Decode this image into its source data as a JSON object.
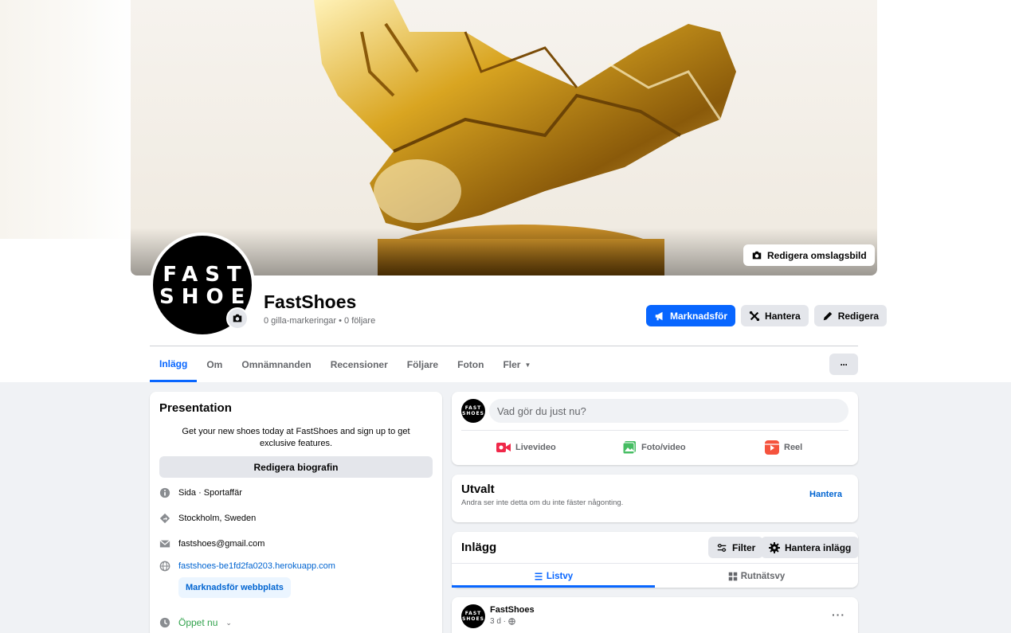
{
  "cover": {
    "edit_label": "Redigera omslagsbild"
  },
  "avatar": {
    "line1": "FAST",
    "line2": "SHOES"
  },
  "page": {
    "name": "FastShoes",
    "stats": "0 gilla-markeringar • 0 följare"
  },
  "actions": {
    "promote": "Marknadsför",
    "manage": "Hantera",
    "edit": "Redigera",
    "more": "···"
  },
  "tabs": [
    "Inlägg",
    "Om",
    "Omnämnanden",
    "Recensioner",
    "Följare",
    "Foton",
    "Fler"
  ],
  "intro": {
    "title": "Presentation",
    "bio": "Get your new shoes today at FastShoes and sign up to get exclusive features.",
    "edit_bio": "Redigera biografin",
    "category": "Sida · Sportaffär",
    "location": "Stockholm, Sweden",
    "email": "fastshoes@gmail.com",
    "website": "fastshoes-be1fd2fa0203.herokuapp.com",
    "promote_website": "Marknadsför webbplats",
    "hours": "Öppet nu"
  },
  "composer": {
    "avatar_line1": "FAST",
    "avatar_line2": "SHOES",
    "placeholder": "Vad gör du just nu?",
    "live": "Livevideo",
    "photo": "Foto/video",
    "reel": "Reel"
  },
  "featured": {
    "title": "Utvalt",
    "subtitle": "Andra ser inte detta om du inte fäster någonting.",
    "manage": "Hantera"
  },
  "posts": {
    "title": "Inlägg",
    "filter": "Filter",
    "manage": "Hantera inlägg",
    "list_view": "Listvy",
    "grid_view": "Rutnätsvy"
  },
  "post": {
    "author": "FastShoes",
    "time": "3 d ·",
    "more": "···"
  },
  "colors": {
    "brand_blue": "#0866ff",
    "link_blue": "#0064d1",
    "open_green": "#31a24c"
  }
}
